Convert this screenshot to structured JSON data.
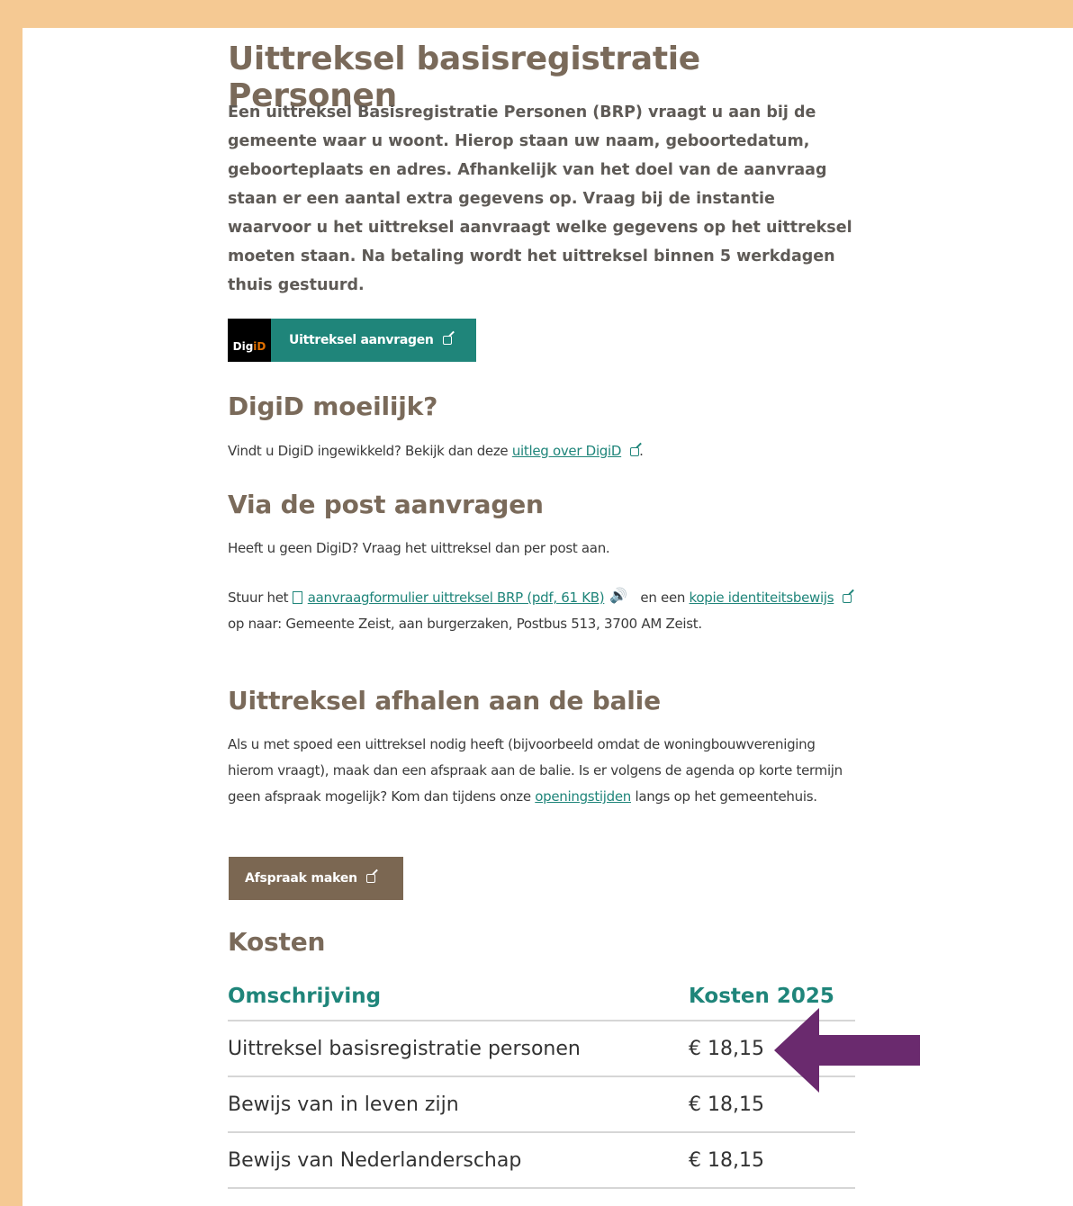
{
  "page": {
    "title": "Uittreksel basisregistratie Personen",
    "intro": "Een uittreksel Basisregistratie Personen (BRP) vraagt u aan bij de gemeente waar u woont. Hierop staan uw naam, geboortedatum, geboorteplaats en adres. Afhankelijk van het doel van de aanvraag staan er een aantal extra gegevens op. Vraag bij de instantie waarvoor u het uittreksel aanvraagt welke gegevens op het uittreksel moeten staan. Na betaling wordt het uittreksel binnen 5 werkdagen thuis gestuurd."
  },
  "digid_button": {
    "logo_part1": "Dig",
    "logo_part2": "iD",
    "label": "Uittreksel aanvragen"
  },
  "digid_moeilijk": {
    "heading": "DigiD moeilijk?",
    "text_before": "Vindt u DigiD ingewikkeld? Bekijk dan deze ",
    "link": "uitleg over DigiD",
    "text_after": "."
  },
  "post": {
    "heading": "Via de post aanvragen",
    "line1": "Heeft u geen DigiD? Vraag het uittreksel dan per post aan.",
    "stuur_prefix": "Stuur het ",
    "form_link": "aanvraagformulier uittreksel BRP (pdf, 61 KB)",
    "mid_text": " en een ",
    "kopie_link": "kopie identiteitsbewijs",
    "suffix": " op naar: Gemeente Zeist, aan burgerzaken, Postbus 513, 3700 AM  Zeist."
  },
  "balie": {
    "heading": "Uittreksel afhalen aan de balie",
    "text": "Als u met spoed een uittreksel nodig heeft (bijvoorbeeld omdat de woningbouwvereniging hierom vraagt), maak dan een afspraak aan de balie. Is er volgens de agenda op korte termijn geen afspraak mogelijk? Kom dan tijdens onze ",
    "link": "openingstijden",
    "text_after": " langs op het gemeentehuis.",
    "button": "Afspraak maken"
  },
  "kosten": {
    "heading": "Kosten",
    "col1": "Omschrijving",
    "col2": "Kosten 2025",
    "rows": [
      {
        "desc": "Uittreksel basisregistratie personen",
        "price": "€ 18,15"
      },
      {
        "desc": "Bewijs van in leven zijn",
        "price": "€ 18,15"
      },
      {
        "desc": "Bewijs van Nederlanderschap",
        "price": "€ 18,15"
      }
    ]
  },
  "colors": {
    "accent": "#1f857a",
    "heading": "#7a6a5a",
    "arrow": "#6a2a6e",
    "frame": "#f5c993"
  }
}
